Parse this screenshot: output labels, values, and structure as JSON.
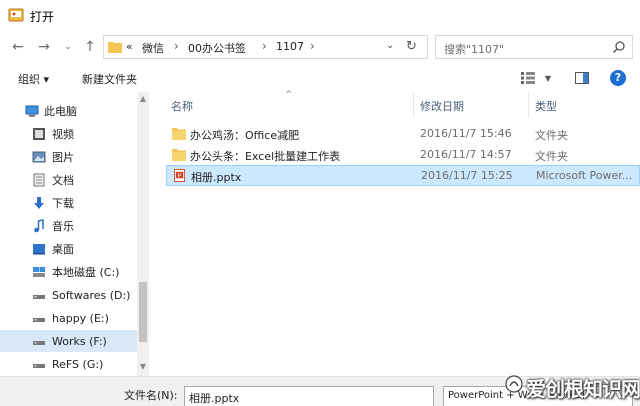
{
  "window": {
    "title": "打开"
  },
  "address": {
    "overflow": "«",
    "crumbs": [
      "微信",
      "00办公书签",
      "1107"
    ],
    "search_placeholder": "搜索\"1107\""
  },
  "toolbar": {
    "organize": "组织 ▾",
    "new_folder": "新建文件夹",
    "help": "?"
  },
  "nav": {
    "items": [
      {
        "label": "此电脑",
        "icon": "pc-icon"
      },
      {
        "label": "视频",
        "icon": "video-icon"
      },
      {
        "label": "图片",
        "icon": "pictures-icon"
      },
      {
        "label": "文档",
        "icon": "documents-icon"
      },
      {
        "label": "下载",
        "icon": "download-icon"
      },
      {
        "label": "音乐",
        "icon": "music-icon"
      },
      {
        "label": "桌面",
        "icon": "desktop-icon"
      },
      {
        "label": "本地磁盘 (C:)",
        "icon": "drive-icon"
      },
      {
        "label": "Softwares (D:)",
        "icon": "drive-icon"
      },
      {
        "label": "happy (E:)",
        "icon": "drive-icon"
      },
      {
        "label": "Works (F:)",
        "icon": "drive-icon",
        "selected": true
      },
      {
        "label": "ReFS (G:)",
        "icon": "drive-icon"
      }
    ]
  },
  "files": {
    "columns": {
      "name": "名称",
      "date": "修改日期",
      "type": "类型"
    },
    "rows": [
      {
        "name": "办公鸡汤：Office减肥",
        "date": "2016/11/7 15:46",
        "type": "文件夹",
        "icon": "folder-icon"
      },
      {
        "name": "办公头条：Excel批量建工作表",
        "date": "2016/11/7 14:57",
        "type": "文件夹",
        "icon": "folder-icon"
      },
      {
        "name": "相册.pptx",
        "date": "2016/11/7 15:25",
        "type": "Microsoft Power...",
        "icon": "pptx-icon",
        "selected": true
      }
    ]
  },
  "bottom": {
    "filename_label": "文件名(N):",
    "filename_value": "相册.pptx",
    "filetype_value": "PowerPoint + Word + Excel"
  },
  "watermark": {
    "text": "爱创根知识网"
  },
  "colors": {
    "selection": "#cce8ff",
    "nav_selection": "#d9e8f7",
    "folder": "#f4c555",
    "accent": "#1e6ed4"
  }
}
